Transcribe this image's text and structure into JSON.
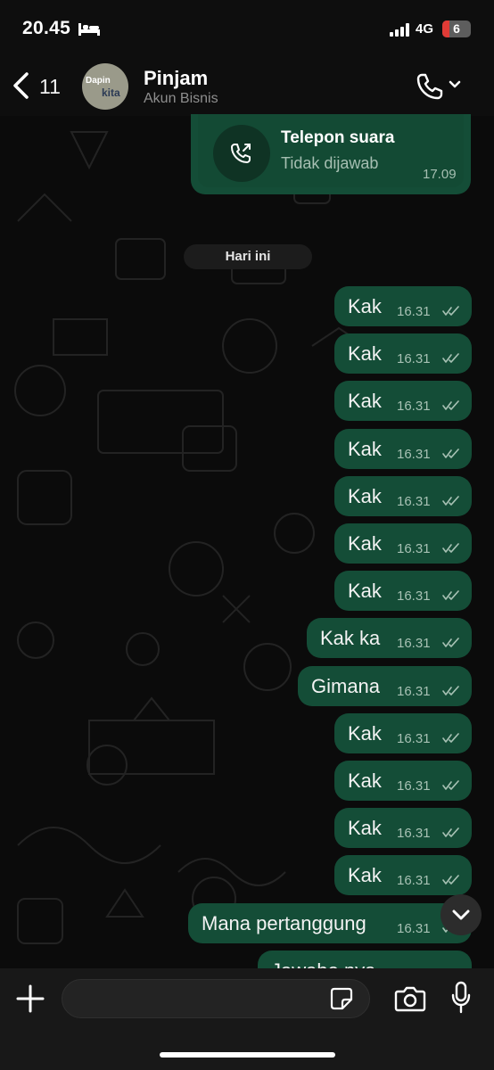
{
  "status_bar": {
    "time": "20.45",
    "network": "4G",
    "battery": "6",
    "battery_level": 0.06
  },
  "header": {
    "back_count": "11",
    "avatar_line1": "Dapin",
    "avatar_line2": "kita",
    "name": "Pinjam",
    "subtitle": "Akun Bisnis"
  },
  "call": {
    "title": "Telepon suara",
    "status": "Tidak dijawab",
    "time": "17.09"
  },
  "date_chip": "Hari ini",
  "messages": [
    {
      "text": "Kak",
      "time": "16.31"
    },
    {
      "text": "Kak",
      "time": "16.31"
    },
    {
      "text": "Kak",
      "time": "16.31"
    },
    {
      "text": "Kak",
      "time": "16.31"
    },
    {
      "text": "Kak",
      "time": "16.31"
    },
    {
      "text": "Kak",
      "time": "16.31"
    },
    {
      "text": "Kak",
      "time": "16.31"
    },
    {
      "text": "Kak ka",
      "time": "16.31"
    },
    {
      "text": "Gimana",
      "time": "16.31"
    },
    {
      "text": "Kak",
      "time": "16.31"
    },
    {
      "text": "Kak",
      "time": "16.31"
    },
    {
      "text": "Kak",
      "time": "16.31"
    },
    {
      "text": "Kak",
      "time": "16.31"
    },
    {
      "text": "Mana pertanggung",
      "time": "16.31"
    },
    {
      "text": "Jawabe nya",
      "time": ""
    }
  ],
  "colors": {
    "bubble": "#144d37",
    "background": "#0b0b0b",
    "meta": "#a7c1b4"
  },
  "icons": [
    "bed-icon",
    "signal-icon",
    "back-icon",
    "phone-icon",
    "chevron-down-icon",
    "missed-call-icon",
    "read-check-icon",
    "plus-icon",
    "sticker-icon",
    "camera-icon",
    "mic-icon"
  ]
}
